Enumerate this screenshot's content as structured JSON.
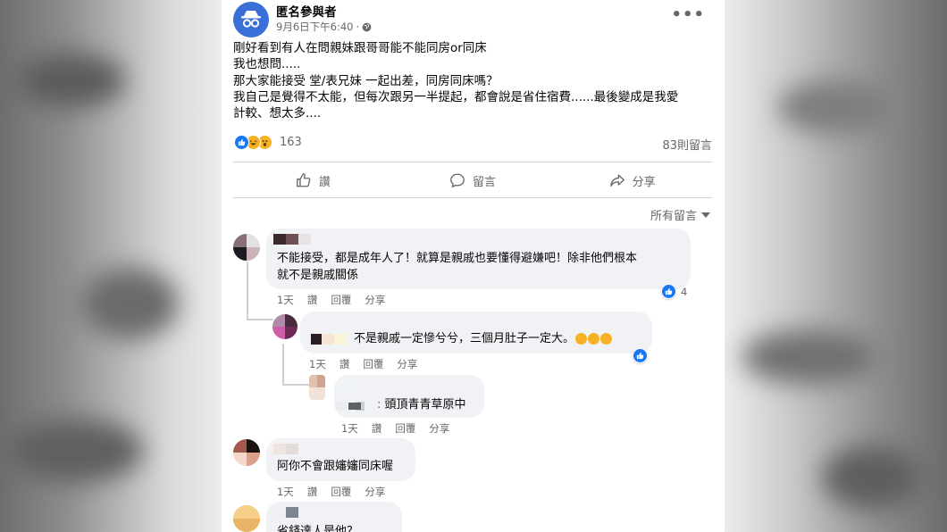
{
  "post": {
    "author": "匿名參與者",
    "timestamp": "9月6日下午6:40",
    "visibility_icon": "globe-icon",
    "more_icon": "more-options-icon",
    "text_lines": [
      "剛好看到有人在問親妹跟哥哥能不能同房or同床",
      "我也想問.....",
      "那大家能接受 堂/表兄妹 一起出差，同房同床嗎？",
      "我自己是覺得不太能，但每次跟另一半提起，都會說是省住宿費......最後變成是我愛",
      "計較、想太多...."
    ],
    "reaction_count": "163",
    "reaction_icons": [
      "like-icon",
      "haha-icon",
      "wow-icon"
    ],
    "comment_count": "83則留言"
  },
  "actions": {
    "like": "讚",
    "comment": "留言",
    "share": "分享"
  },
  "sort_label": "所有留言",
  "comments": [
    {
      "text_lines": [
        "不能接受，都是成年人了！就算是親戚也要懂得避嫌吧！除非他們根本",
        "就不是親戚關係"
      ],
      "time": "1天",
      "like": "讚",
      "reply": "回覆",
      "share": "分享",
      "like_count": "4"
    },
    {
      "text": "不是親戚一定慘兮兮，三個月肚子一定大。",
      "time": "1天",
      "like": "讚",
      "reply": "回覆",
      "share": "分享"
    },
    {
      "text": "頭頂青青草原中",
      "time": "1天",
      "like": "讚",
      "reply": "回覆",
      "share": "分享"
    },
    {
      "text": "阿你不會跟嬸嬸同床喔",
      "time": "1天",
      "like": "讚",
      "reply": "回覆",
      "share": "分享"
    },
    {
      "text": "省錢達人是他？"
    }
  ],
  "colors": {
    "accent": "#1877f2",
    "bubble": "#f0f2f5",
    "muted": "#65676b"
  }
}
